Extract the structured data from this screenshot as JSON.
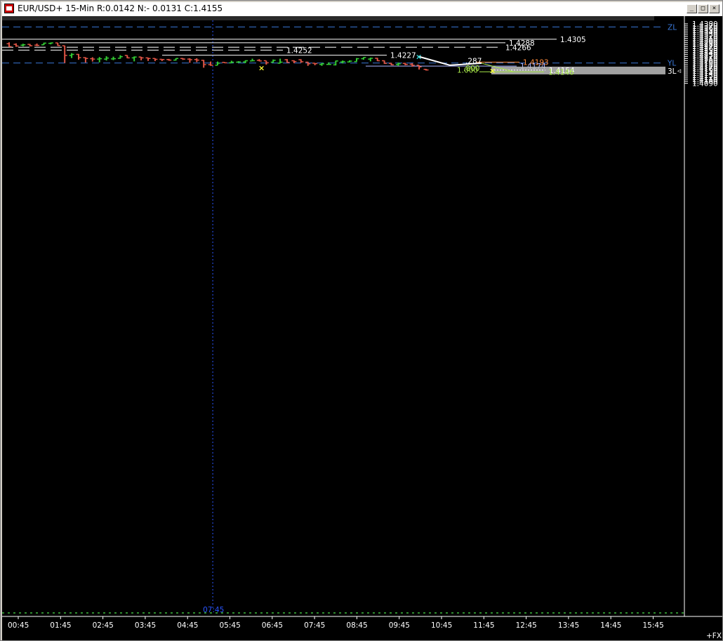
{
  "window": {
    "title": "EUR/USD+ 15-Min R:0.0142 N:- 0.0131 C:1.4155",
    "minimize_glyph": "_",
    "maximize_glyph": "□",
    "close_glyph": "×"
  },
  "icons": {
    "app": "chart-app-icon"
  },
  "colors": {
    "background": "#000000",
    "up_bar": "#33cc33",
    "down_bar": "#e05545",
    "level_line": "#ffffff",
    "blue_level": "#3a78d8",
    "orange_level": "#ff8c3c",
    "lavender_level": "#aab4ff",
    "fib_green": "#a8e84a",
    "cursor": "#2a55ff"
  },
  "chart_data": {
    "type": "ohlc",
    "symbol": "EUR/USD+",
    "timeframe": "15-Min",
    "header_stats": {
      "R": "0.0142",
      "N": "- 0.0131",
      "C": "1.4155"
    },
    "y_axis": {
      "range": [
        1.409,
        1.4385
      ],
      "tick_labels": [
        "1.4380",
        "1.4370",
        "1.4360",
        "1.4350",
        "1.4340",
        "1.4330",
        "1.4320",
        "1.4310",
        "1.4300",
        "1.4290",
        "1.4280",
        "1.4270",
        "1.4260",
        "1.4250",
        "1.4240",
        "1.4230",
        "1.4220",
        "1.4210",
        "1.4200",
        "1.4190",
        "1.4180",
        "1.4170",
        "1.4160",
        "1.4150",
        "1.4140",
        "1.4130",
        "1.4120",
        "1.4110",
        "1.4100",
        "1.4090"
      ]
    },
    "x_axis": {
      "tick_labels": [
        "00:45",
        "01:45",
        "02:45",
        "03:45",
        "04:45",
        "05:45",
        "06:45",
        "07:45",
        "08:45",
        "09:45",
        "10:45",
        "11:45",
        "12:45",
        "13:45",
        "14:45",
        "15:45"
      ],
      "corner_label": "+FX"
    },
    "bars": [
      {
        "o": 1.4283,
        "h": 1.429,
        "l": 1.4267,
        "c": 1.4269
      },
      {
        "o": 1.428,
        "h": 1.4285,
        "l": 1.4268,
        "c": 1.4272
      },
      {
        "o": 1.4276,
        "h": 1.4283,
        "l": 1.427,
        "c": 1.4278
      },
      {
        "o": 1.428,
        "h": 1.4282,
        "l": 1.427,
        "c": 1.4273
      },
      {
        "o": 1.4276,
        "h": 1.4284,
        "l": 1.4271,
        "c": 1.4275
      },
      {
        "o": 1.4278,
        "h": 1.4288,
        "l": 1.4277,
        "c": 1.4286
      },
      {
        "o": 1.4285,
        "h": 1.4289,
        "l": 1.428,
        "c": 1.4287
      },
      {
        "o": 1.4287,
        "h": 1.4288,
        "l": 1.4273,
        "c": 1.4274
      },
      {
        "o": 1.4273,
        "h": 1.4274,
        "l": 1.4189,
        "c": 1.4226
      },
      {
        "o": 1.4226,
        "h": 1.4237,
        "l": 1.4213,
        "c": 1.4231
      },
      {
        "o": 1.4231,
        "h": 1.4233,
        "l": 1.4205,
        "c": 1.4215
      },
      {
        "o": 1.4215,
        "h": 1.4217,
        "l": 1.4191,
        "c": 1.4211
      },
      {
        "o": 1.421,
        "h": 1.4217,
        "l": 1.4196,
        "c": 1.4208
      },
      {
        "o": 1.4208,
        "h": 1.4218,
        "l": 1.4192,
        "c": 1.421
      },
      {
        "o": 1.4208,
        "h": 1.4222,
        "l": 1.4201,
        "c": 1.4213
      },
      {
        "o": 1.4209,
        "h": 1.422,
        "l": 1.4203,
        "c": 1.421
      },
      {
        "o": 1.4212,
        "h": 1.4227,
        "l": 1.421,
        "c": 1.422
      },
      {
        "o": 1.4226,
        "h": 1.4227,
        "l": 1.4212,
        "c": 1.4214
      },
      {
        "o": 1.4214,
        "h": 1.4221,
        "l": 1.4197,
        "c": 1.4218
      },
      {
        "o": 1.4218,
        "h": 1.4219,
        "l": 1.4202,
        "c": 1.4214
      },
      {
        "o": 1.4214,
        "h": 1.4215,
        "l": 1.4199,
        "c": 1.4211
      },
      {
        "o": 1.4211,
        "h": 1.4212,
        "l": 1.4198,
        "c": 1.4207
      },
      {
        "o": 1.4207,
        "h": 1.4208,
        "l": 1.4198,
        "c": 1.4206
      },
      {
        "o": 1.4206,
        "h": 1.4209,
        "l": 1.42,
        "c": 1.4203
      },
      {
        "o": 1.4203,
        "h": 1.4212,
        "l": 1.4201,
        "c": 1.4211
      },
      {
        "o": 1.4211,
        "h": 1.4213,
        "l": 1.4204,
        "c": 1.4208
      },
      {
        "o": 1.4208,
        "h": 1.4212,
        "l": 1.419,
        "c": 1.4205
      },
      {
        "o": 1.4206,
        "h": 1.4212,
        "l": 1.4193,
        "c": 1.4203
      },
      {
        "o": 1.4202,
        "h": 1.4204,
        "l": 1.4166,
        "c": 1.4181
      },
      {
        "o": 1.4181,
        "h": 1.4196,
        "l": 1.4175,
        "c": 1.4178
      },
      {
        "o": 1.4178,
        "h": 1.4196,
        "l": 1.4178,
        "c": 1.4188
      },
      {
        "o": 1.4192,
        "h": 1.4193,
        "l": 1.4188,
        "c": 1.419
      },
      {
        "o": 1.419,
        "h": 1.42,
        "l": 1.4188,
        "c": 1.4193
      },
      {
        "o": 1.4193,
        "h": 1.4198,
        "l": 1.419,
        "c": 1.4194
      },
      {
        "o": 1.4194,
        "h": 1.4202,
        "l": 1.4188,
        "c": 1.42
      },
      {
        "o": 1.4199,
        "h": 1.421,
        "l": 1.4198,
        "c": 1.42
      },
      {
        "o": 1.4202,
        "h": 1.4208,
        "l": 1.4197,
        "c": 1.4199
      },
      {
        "o": 1.42,
        "h": 1.42,
        "l": 1.4181,
        "c": 1.419
      },
      {
        "o": 1.4193,
        "h": 1.4206,
        "l": 1.4191,
        "c": 1.4202
      },
      {
        "o": 1.4188,
        "h": 1.421,
        "l": 1.4187,
        "c": 1.4193
      },
      {
        "o": 1.4205,
        "h": 1.4208,
        "l": 1.419,
        "c": 1.4192
      },
      {
        "o": 1.42,
        "h": 1.4202,
        "l": 1.4188,
        "c": 1.4196
      },
      {
        "o": 1.4205,
        "h": 1.4207,
        "l": 1.419,
        "c": 1.4195
      },
      {
        "o": 1.4193,
        "h": 1.4195,
        "l": 1.4175,
        "c": 1.4185
      },
      {
        "o": 1.4188,
        "h": 1.4189,
        "l": 1.4178,
        "c": 1.4186
      },
      {
        "o": 1.4182,
        "h": 1.4189,
        "l": 1.4175,
        "c": 1.4185
      },
      {
        "o": 1.4182,
        "h": 1.4192,
        "l": 1.418,
        "c": 1.4182
      },
      {
        "o": 1.418,
        "h": 1.42,
        "l": 1.4177,
        "c": 1.4199
      },
      {
        "o": 1.4194,
        "h": 1.4201,
        "l": 1.4187,
        "c": 1.4196
      },
      {
        "o": 1.4194,
        "h": 1.4202,
        "l": 1.4192,
        "c": 1.4198
      },
      {
        "o": 1.4196,
        "h": 1.4213,
        "l": 1.4195,
        "c": 1.421
      },
      {
        "o": 1.421,
        "h": 1.4217,
        "l": 1.4205,
        "c": 1.4216
      },
      {
        "o": 1.4208,
        "h": 1.4215,
        "l": 1.4197,
        "c": 1.4212
      },
      {
        "o": 1.4212,
        "h": 1.4214,
        "l": 1.4198,
        "c": 1.42
      },
      {
        "o": 1.42,
        "h": 1.4201,
        "l": 1.4185,
        "c": 1.4187
      },
      {
        "o": 1.4187,
        "h": 1.419,
        "l": 1.4178,
        "c": 1.418
      },
      {
        "o": 1.4182,
        "h": 1.4191,
        "l": 1.4175,
        "c": 1.4185
      },
      {
        "o": 1.4187,
        "h": 1.419,
        "l": 1.4178,
        "c": 1.4182
      },
      {
        "o": 1.4183,
        "h": 1.4188,
        "l": 1.4171,
        "c": 1.4178
      },
      {
        "o": 1.4178,
        "h": 1.4178,
        "l": 1.4157,
        "c": 1.417
      },
      {
        "o": 1.4158,
        "h": 1.416,
        "l": 1.4152,
        "c": 1.4155
      }
    ],
    "horizontal_levels": [
      {
        "value": 1.4305,
        "label": "1.4305",
        "style": "solid",
        "color": "#ffffff"
      },
      {
        "value": 1.4288,
        "label": "1.4288",
        "style": "solid",
        "color": "#ffffff"
      },
      {
        "value": 1.4266,
        "label": "1.4266",
        "style": "dashed",
        "color": "#ffffff"
      },
      {
        "value": 1.4252,
        "label": "1.4252",
        "style": "dashed",
        "color": "#ffffff"
      },
      {
        "value": 1.4227,
        "label": "1.4227",
        "style": "solid",
        "color": "#ffffff"
      },
      {
        "value": 1.4193,
        "label": "1.4193",
        "style": "solid",
        "color": "#ff8c3c"
      },
      {
        "value": 1.4174,
        "label": "1.4174",
        "style": "solid",
        "color": "#aab4ff"
      },
      {
        "value": 1.4154,
        "label": "1.4154",
        "style": "dotted",
        "color": "#ffffff"
      },
      {
        "value": 1.4146,
        "label": "1.4146",
        "style": "solid",
        "color": "#a8e84a"
      }
    ],
    "zone_lines": [
      {
        "value": 1.4365,
        "label": "ZL",
        "color": "#3a78d8"
      },
      {
        "value": 1.4189,
        "label": "YL",
        "color": "#3a78d8"
      }
    ],
    "fib_labels": [
      {
        "value": 1.4189,
        "label": ".287"
      },
      {
        "value": 1.4154,
        "label": ".800"
      },
      {
        "value": 1.4146,
        "label": "1.000"
      }
    ],
    "pivot_markers": [
      {
        "value": 1.4166,
        "kind": "low",
        "color": "#ffff33"
      },
      {
        "value": 1.4221,
        "kind": "high",
        "color": "#33dddd"
      },
      {
        "value": 1.4152,
        "kind": "low",
        "color": "#ffff33"
      }
    ],
    "current_price_label": "3L",
    "crosshair_time": "07:45"
  }
}
